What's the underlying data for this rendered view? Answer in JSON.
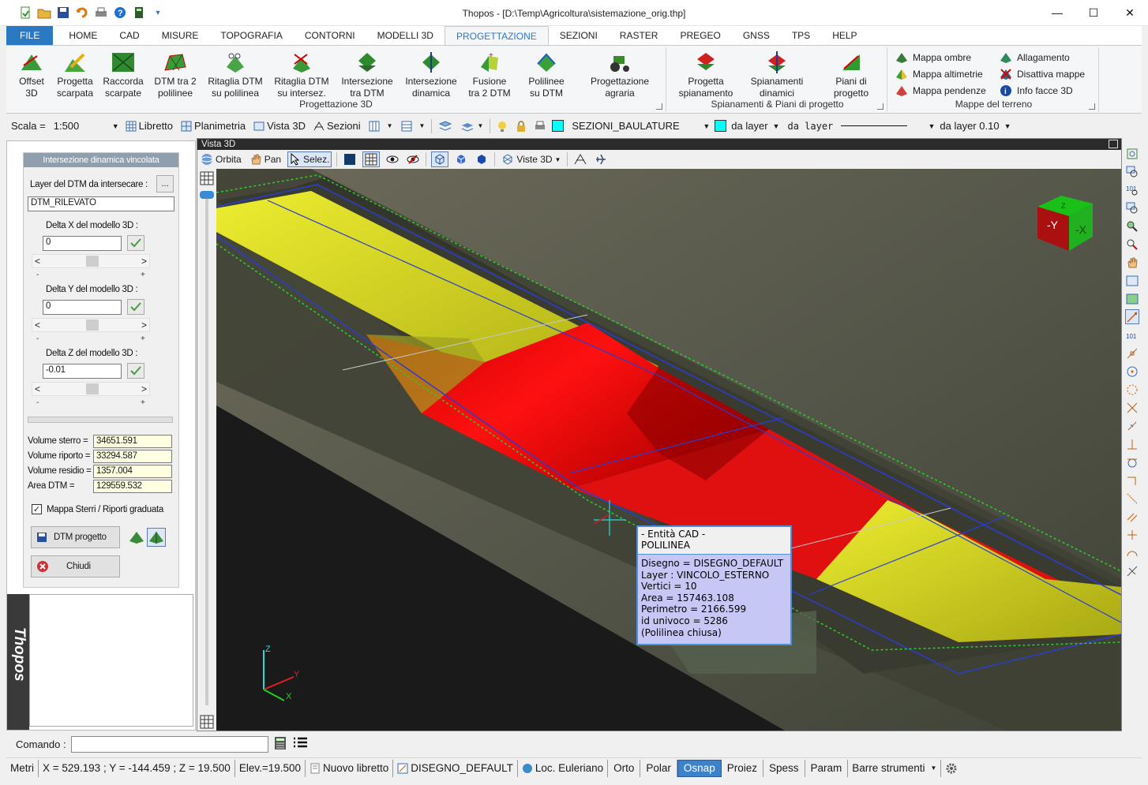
{
  "window": {
    "title": "Thopos - [D:\\Temp\\Agricoltura\\sistemazione_orig.thp]",
    "controls": [
      "minimize",
      "maximize",
      "close"
    ]
  },
  "quick_access": [
    "new-icon",
    "open-icon",
    "save-icon",
    "undo-icon",
    "print-icon",
    "help-icon",
    "calculator-icon",
    "dropdown-icon"
  ],
  "ribbon_tabs": [
    {
      "label": "FILE"
    },
    {
      "label": "HOME"
    },
    {
      "label": "CAD"
    },
    {
      "label": "MISURE"
    },
    {
      "label": "TOPOGRAFIA"
    },
    {
      "label": "CONTORNI"
    },
    {
      "label": "MODELLI 3D"
    },
    {
      "label": "PROGETTAZIONE",
      "active": true
    },
    {
      "label": "SEZIONI"
    },
    {
      "label": "RASTER"
    },
    {
      "label": "PREGEO"
    },
    {
      "label": "GNSS"
    },
    {
      "label": "TPS"
    },
    {
      "label": "HELP"
    }
  ],
  "ribbon": {
    "group1": {
      "label": "Progettazione 3D",
      "buttons": [
        {
          "l1": "Offset",
          "l2": "3D"
        },
        {
          "l1": "Progetta",
          "l2": "scarpata"
        },
        {
          "l1": "Raccorda",
          "l2": "scarpate"
        },
        {
          "l1": "DTM tra 2",
          "l2": "polilinee"
        },
        {
          "l1": "Ritaglia DTM",
          "l2": "su polilinea"
        },
        {
          "l1": "Ritaglia DTM",
          "l2": "su intersez."
        },
        {
          "l1": "Intersezione",
          "l2": "tra DTM"
        },
        {
          "l1": "Intersezione",
          "l2": "dinamica"
        },
        {
          "l1": "Fusione",
          "l2": "tra 2 DTM"
        },
        {
          "l1": "Polilinee",
          "l2": "su DTM"
        },
        {
          "l1": "Progettazione",
          "l2": "agraria"
        }
      ]
    },
    "group2": {
      "label": "Spianamenti & Piani di progetto",
      "buttons": [
        {
          "l1": "Progetta",
          "l2": "spianamento"
        },
        {
          "l1": "Spianamenti",
          "l2": "dinamici"
        },
        {
          "l1": "Piani di",
          "l2": "progetto"
        }
      ]
    },
    "group3": {
      "label": "Mappe del terreno",
      "items": [
        "Mappa ombre",
        "Mappa altimetrie",
        "Mappa pendenze",
        "Allagamento",
        "Disattiva mappe",
        "Info facce 3D"
      ]
    }
  },
  "toolbar": {
    "scale_label": "Scala =",
    "scale_value": "1:500",
    "libretto": "Libretto",
    "planimetria": "Planimetria",
    "vista3d": "Vista 3D",
    "sezioni": "Sezioni",
    "layer_name": "SEZIONI_BAULATURE",
    "layer_color": "#00ffff",
    "color_mode": "da layer",
    "linetype": "da layer",
    "lineweight": "da layer 0.10"
  },
  "panel": {
    "title": "Intersezione dinamica vincolata",
    "layer_label": "Layer del DTM da intersecare :",
    "browse": "...",
    "layer_value": "DTM_RILEVATO",
    "dx_label": "Delta X del modello 3D :",
    "dx_value": "0",
    "dy_label": "Delta Y del modello 3D :",
    "dy_value": "0",
    "dz_label": "Delta Z del modello 3D :",
    "dz_value": "-0.01",
    "minus": "-",
    "plus": "+",
    "left_arrow": "<",
    "right_arrow": ">",
    "vol_sterro_label": "Volume sterro =",
    "vol_sterro": "34651.591",
    "vol_riporto_label": "Volume riporto =",
    "vol_riporto": "33294.587",
    "vol_residuo_label": "Volume residio =",
    "vol_residuo": "1357.004",
    "area_label": "Area DTM =",
    "area": "129559.532",
    "mappa_label": "Mappa Sterri / Riporti graduata",
    "mappa_checked": true,
    "dtm_button": "DTM progetto",
    "close_button": "Chiudi",
    "brand": "Thopos"
  },
  "view": {
    "title": "Vista 3D",
    "orbit": "Orbita",
    "pan": "Pan",
    "select": "Selez.",
    "views": "Viste 3D"
  },
  "tooltip": {
    "header1": "- Entità CAD -",
    "header2": "POLILINEA",
    "lines": [
      "Disegno = DISEGNO_DEFAULT",
      "Layer : VINCOLO_ESTERNO",
      "Vertici = 10",
      "Area = 157463.108",
      "Perimetro = 2166.599",
      "id univoco = 5286",
      "(Polilinea chiusa)"
    ]
  },
  "viewcube": {
    "face_left": "-Y",
    "face_right": "-X",
    "face_top": "Z"
  },
  "axes": {
    "z": "Z",
    "y": "Y",
    "x": "X"
  },
  "command": {
    "label": "Comando :",
    "value": ""
  },
  "status": {
    "units": "Metri",
    "coords": "X = 529.193 ; Y = -144.459 ; Z = 19.500",
    "elev": "Elev.=19.500",
    "libretto": "Nuovo libretto",
    "drawing": "DISEGNO_DEFAULT",
    "loc": "Loc. Euleriano",
    "orto": "Orto",
    "polar": "Polar",
    "osnap": "Osnap",
    "proiez": "Proiez",
    "spess": "Spess",
    "param": "Param",
    "barre": "Barre strumenti"
  },
  "colors": {
    "accent": "#2b79c2",
    "cut": "#ff1a1a",
    "fill": "#e6e61a",
    "tooltip": "#c7c7f5"
  }
}
